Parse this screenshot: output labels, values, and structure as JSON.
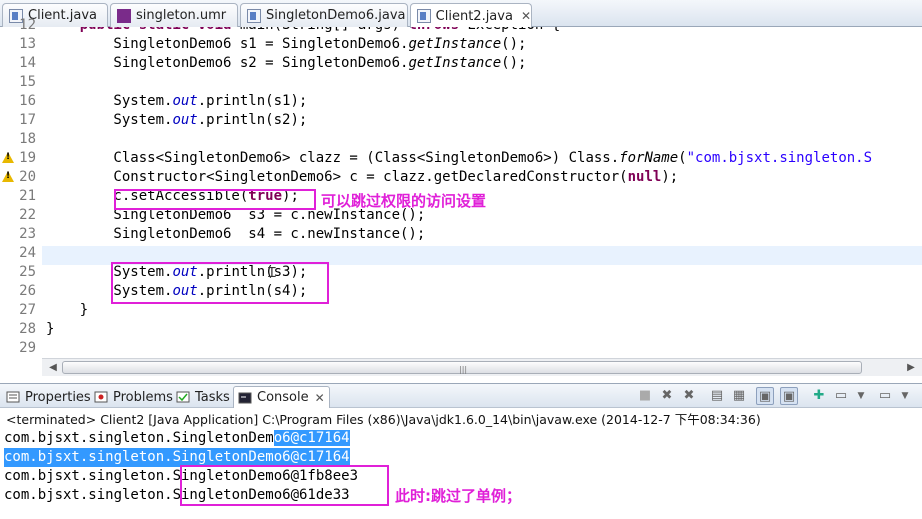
{
  "editor_tabs": [
    {
      "label": "Client.java",
      "icon": "java-file-icon"
    },
    {
      "label": "singleton.umr",
      "icon": "uml-model-icon"
    },
    {
      "label": "SingletonDemo6.java",
      "icon": "java-file-icon"
    },
    {
      "label": "Client2.java",
      "icon": "java-file-icon",
      "active": true,
      "close": "✕"
    }
  ],
  "code": {
    "lines": [
      {
        "num": "12",
        "segments": [
          [
            "",
            "    "
          ],
          [
            "kw",
            "public static void"
          ],
          [
            "",
            " main(String[] args) "
          ],
          [
            "kw",
            "throws"
          ],
          [
            "",
            " Exception {"
          ]
        ]
      },
      {
        "num": "13",
        "segments": [
          [
            "",
            "        SingletonDemo6 s1 = SingletonDemo6."
          ],
          [
            "itl",
            "getInstance"
          ],
          [
            "",
            "();"
          ]
        ]
      },
      {
        "num": "14",
        "segments": [
          [
            "",
            "        SingletonDemo6 s2 = SingletonDemo6."
          ],
          [
            "itl",
            "getInstance"
          ],
          [
            "",
            "();"
          ]
        ]
      },
      {
        "num": "15",
        "segments": [
          [
            "",
            ""
          ]
        ]
      },
      {
        "num": "16",
        "segments": [
          [
            "",
            "        System."
          ],
          [
            "fld",
            "out"
          ],
          [
            "",
            ".println(s1);"
          ]
        ]
      },
      {
        "num": "17",
        "segments": [
          [
            "",
            "        System."
          ],
          [
            "fld",
            "out"
          ],
          [
            "",
            ".println(s2);"
          ]
        ]
      },
      {
        "num": "18",
        "segments": [
          [
            "",
            ""
          ]
        ]
      },
      {
        "num": "19",
        "warning": true,
        "segments": [
          [
            "",
            "        Class<SingletonDemo6> clazz = (Class<SingletonDemo6>) Class."
          ],
          [
            "itl",
            "forName"
          ],
          [
            "",
            "("
          ],
          [
            "str",
            "\"com.bjsxt.singleton.S"
          ]
        ]
      },
      {
        "num": "20",
        "warning": true,
        "segments": [
          [
            "",
            "        Constructor<SingletonDemo6> c = clazz.getDeclaredConstructor("
          ],
          [
            "kw",
            "null"
          ],
          [
            "",
            ");"
          ]
        ]
      },
      {
        "num": "21",
        "segments": [
          [
            "",
            "        c.setAccessible("
          ],
          [
            "kw",
            "true"
          ],
          [
            "",
            ");"
          ]
        ]
      },
      {
        "num": "22",
        "segments": [
          [
            "",
            "        SingletonDemo6  s3 = c.newInstance();"
          ]
        ]
      },
      {
        "num": "23",
        "segments": [
          [
            "",
            "        SingletonDemo6  s4 = c.newInstance();"
          ]
        ]
      },
      {
        "num": "24",
        "segments": [
          [
            "",
            ""
          ]
        ]
      },
      {
        "num": "25",
        "segments": [
          [
            "",
            "        System."
          ],
          [
            "fld",
            "out"
          ],
          [
            "",
            ".println(s3);"
          ]
        ]
      },
      {
        "num": "26",
        "segments": [
          [
            "",
            "        System."
          ],
          [
            "fld",
            "out"
          ],
          [
            "",
            ".println(s4);"
          ]
        ]
      },
      {
        "num": "27",
        "segments": [
          [
            "",
            "    }"
          ]
        ]
      },
      {
        "num": "28",
        "segments": [
          [
            "",
            "}"
          ]
        ]
      },
      {
        "num": "29",
        "segments": [
          [
            "",
            ""
          ]
        ]
      }
    ],
    "annotation_1": "可以跳过权限的访问设置",
    "annotation_2": "此时:跳过了单例；"
  },
  "console_tabs": [
    {
      "label": "Properties",
      "icon": "properties-icon"
    },
    {
      "label": "Problems",
      "icon": "problems-icon"
    },
    {
      "label": "Tasks",
      "icon": "tasks-icon"
    },
    {
      "label": "Console",
      "icon": "console-icon",
      "active": true,
      "close": "✕"
    }
  ],
  "console": {
    "terminated": "<terminated> Client2 [Java Application] C:\\Program Files (x86)\\Java\\jdk1.6.0_14\\bin\\javaw.exe (2014-12-7 下午08:34:36)",
    "output": [
      "com.bjsxt.singleton.SingletonDemo6@c17164",
      "com.bjsxt.singleton.SingletonDemo6@c17164",
      "com.bjsxt.singleton.SingletonDemo6@1fb8ee3",
      "com.bjsxt.singleton.SingletonDemo6@61de33"
    ]
  },
  "colors": {
    "keyword": "#7f0055",
    "field": "#0000c0",
    "string": "#2a00ff",
    "annotation": "#e020d8",
    "selection": "#3399ff"
  }
}
